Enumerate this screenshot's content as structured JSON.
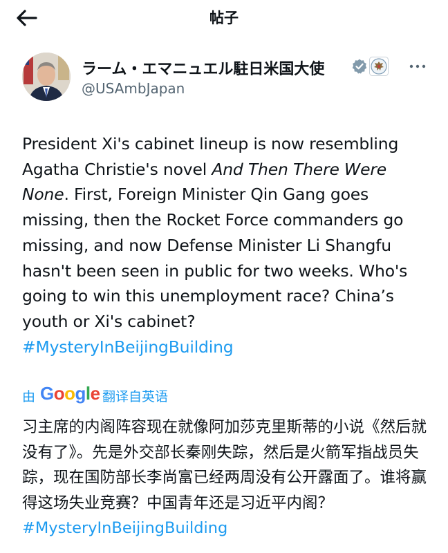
{
  "header": {
    "title": "帖子",
    "back_icon": "arrow-left-icon"
  },
  "author": {
    "display_name": "ラーム・エマニュエル駐日米国大使",
    "handle": "@USAmbJapan",
    "verified_icon": "verified-badge-icon",
    "affiliation_icon": "us-government-seal-icon",
    "more_icon": "more-options-icon"
  },
  "tweet": {
    "text_part1": "President Xi's cabinet lineup is now resembling Agatha Christie's novel ",
    "text_italic": "And Then There Were None",
    "text_part2": ". First, Foreign Minister Qin Gang goes missing, then the Rocket Force commanders go missing, and now Defense Minister Li Shangfu hasn't been seen in public for two weeks. Who's going to win this unemployment race? China’s youth or Xi's cabinet?",
    "hashtag": "#MysteryInBeijingBuilding"
  },
  "translation": {
    "by": "由",
    "provider": "Google",
    "label": "翻译自英语",
    "text": "习主席的内阁阵容现在就像阿加莎克里斯蒂的小说《然后就没有了》。先是外交部长秦刚失踪，然后是火箭军指战员失踪，现在国防部长李尚富已经两周没有公开露面了。谁将赢得这场失业竞赛？中国青年还是习近平内阁？",
    "hashtag": "#MysteryInBeijingBuilding"
  },
  "colors": {
    "link": "#1d9bf0",
    "text": "#0f1419",
    "secondary": "#536471",
    "verified": "#829aab"
  }
}
